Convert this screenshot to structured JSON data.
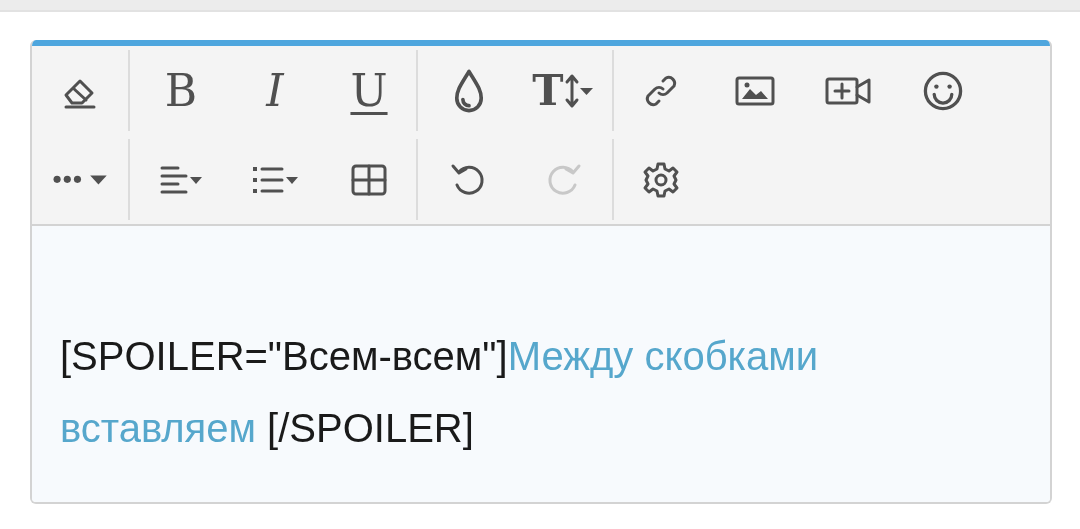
{
  "toolbar": {
    "rows": [
      [
        {
          "buttons": [
            {
              "kind": "eraser",
              "disabled": false
            }
          ]
        },
        {
          "buttons": [
            {
              "kind": "bold",
              "label": "B",
              "disabled": false
            },
            {
              "kind": "italic",
              "label": "I",
              "disabled": false
            },
            {
              "kind": "underline",
              "label": "U",
              "disabled": false
            }
          ]
        },
        {
          "buttons": [
            {
              "kind": "color",
              "disabled": false
            },
            {
              "kind": "font-size",
              "label": "T",
              "disabled": false
            }
          ]
        },
        {
          "buttons": [
            {
              "kind": "link",
              "disabled": false
            },
            {
              "kind": "image",
              "disabled": false
            },
            {
              "kind": "video",
              "disabled": false
            },
            {
              "kind": "smiley",
              "disabled": false
            }
          ]
        }
      ],
      [
        {
          "buttons": [
            {
              "kind": "more",
              "disabled": false
            }
          ]
        },
        {
          "buttons": [
            {
              "kind": "align",
              "disabled": false
            },
            {
              "kind": "list",
              "disabled": false
            },
            {
              "kind": "table",
              "disabled": false
            }
          ]
        },
        {
          "buttons": [
            {
              "kind": "undo",
              "disabled": false
            },
            {
              "kind": "redo",
              "disabled": true
            }
          ]
        },
        {
          "buttons": [
            {
              "kind": "settings",
              "disabled": false
            }
          ]
        }
      ]
    ]
  },
  "editor": {
    "segments": [
      {
        "kind": "tag",
        "text": "[SPOILER=\"Всем-всем\"]"
      },
      {
        "kind": "highlight",
        "text": "Между скобками вставляем"
      },
      {
        "kind": "tag",
        "text": " [/SPOILER]"
      }
    ]
  }
}
